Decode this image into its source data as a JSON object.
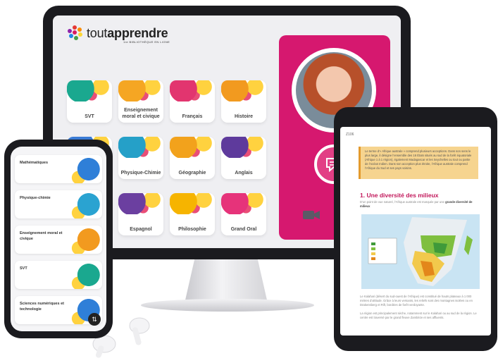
{
  "brand": {
    "name_light": "tout",
    "name_bold": "apprendre",
    "tagline": "1re BIBLIOTHÈQUE EN LIGNE",
    "dot_colors": [
      "#e53935",
      "#fb8c00",
      "#fdd835",
      "#43a047",
      "#1e88e5",
      "#8e24aa",
      "#d81b60"
    ]
  },
  "desktop": {
    "subjects": [
      {
        "label": "SVT",
        "color": "#1aa88f"
      },
      {
        "label": "Enseignement moral et civique",
        "color": "#f5a623"
      },
      {
        "label": "Français",
        "color": "#e2356f"
      },
      {
        "label": "Histoire",
        "color": "#f29a1f"
      },
      {
        "label": "",
        "color": "#3a7bd5"
      },
      {
        "label": "Physique-Chimie",
        "color": "#25a0c8"
      },
      {
        "label": "Géographie",
        "color": "#f2a21c"
      },
      {
        "label": "Anglais",
        "color": "#5e3a9c"
      },
      {
        "label": "",
        "color": "#e94e77"
      },
      {
        "label": "Espagnol",
        "color": "#6b3fa0"
      },
      {
        "label": "Philosophie",
        "color": "#f6b400"
      },
      {
        "label": "Grand Oral",
        "color": "#e6337a"
      }
    ],
    "call_card": {
      "accent": "#d6186f"
    }
  },
  "phone": {
    "rows": [
      {
        "label": "Mathématiques",
        "color": "#2f7fd8"
      },
      {
        "label": "Physique-chimie",
        "color": "#2aa3d1"
      },
      {
        "label": "Enseignement moral et civique",
        "color": "#f29a1f"
      },
      {
        "label": "SVT",
        "color": "#1aa88f"
      },
      {
        "label": "Sciences numériques et technologie",
        "color": "#2f7fd8"
      }
    ],
    "fab_icon": "⇅"
  },
  "tablet": {
    "page_label": "Z106",
    "intro": "Le terme d’« Afrique australe » comprend plusieurs acceptions. Dans son sens le plus large, il désigne l’ensemble des 16 États situés au sud de la forêt équatoriale (Afrique 1 à 1 région), également Madagascar et les Seychelles ou tout ou partie de l’océan Indien. Dans son acception plus étroite, l’Afrique australe comprend l’Afrique du Sud et ses pays voisins.",
    "heading": "1. Une diversité des milieux",
    "para1": "D’un point de vue naturel, l’Afrique australe est marquée par une",
    "para1_bold": "grande diversité de milieux",
    "para2": "Le Kalahari (désert du sud-ouest de l’Afrique) est constitué de hauts plateaux à 1 000 mètres d’altitude. Grâce à leurs versants, les reliefs sont des montagnes isolées ou en Drakensberg et Rift, bordées de forêt verdoyante.",
    "para3": "La région est principalement sèche, notamment sur le Kalahari ou au sud de la région. Le centre est traversé par le grand fleuve Zambèze et ses affluents."
  }
}
